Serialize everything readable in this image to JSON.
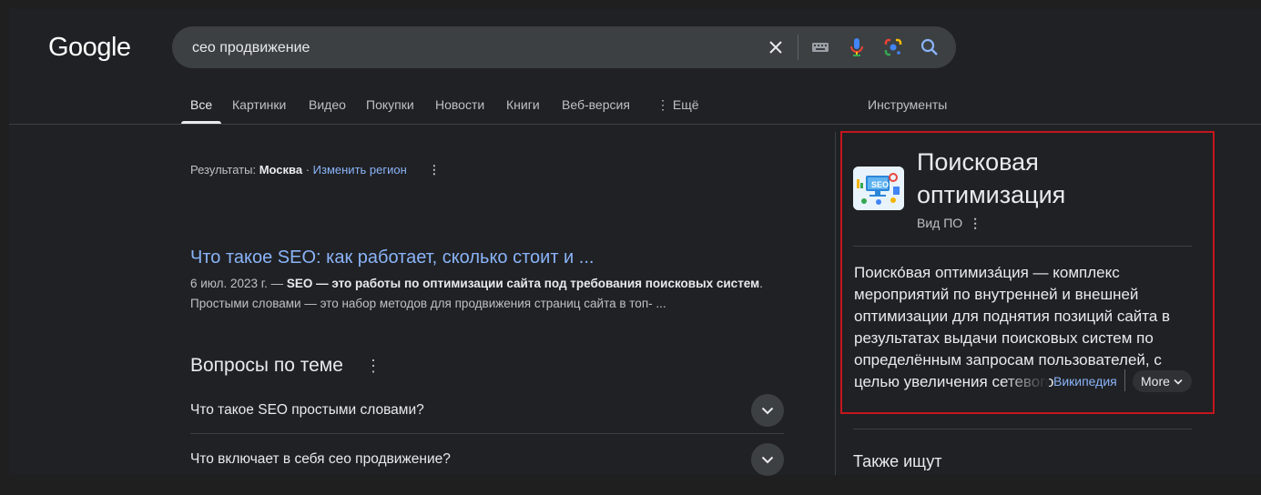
{
  "header": {
    "logo_text": "Google",
    "search_value": "сео продвижение",
    "icons": [
      "close-icon",
      "keyboard-icon",
      "microphone-icon",
      "google-lens-icon",
      "search-icon"
    ]
  },
  "tabs": {
    "all": "Все",
    "images": "Картинки",
    "video": "Видео",
    "shopping": "Покупки",
    "news": "Новости",
    "books": "Книги",
    "web": "Веб-версия",
    "more": "⋮ Ещё",
    "tools": "Инструменты"
  },
  "region": {
    "prefix": "Результаты: ",
    "city": "Москва",
    "separator": " · ",
    "change_link": "Изменить регион"
  },
  "result": {
    "title": "Что такое SEO: как работает, сколько стоит и ...",
    "date": "6 июл. 2023 г. — ",
    "snippet_bold": "SEO — это работы по оптимизации сайта под требования поисковых систем",
    "snippet_rest": ". Простыми словами — это набор методов для продвижения страниц сайта в топ- ..."
  },
  "paa": {
    "title": "Вопросы по теме",
    "questions": [
      "Что такое SEO простыми словами?",
      "Что включает в себя сео продвижение?"
    ]
  },
  "knowledge_panel": {
    "title": "Поисковая оптимизация",
    "subtitle": "Вид ПО",
    "description": "Поиско́вая оптимиза́ция — комплекс мероприятий по внутренней и внешней оптимизации для поднятия позиций сайта в результатах выдачи поисковых систем по определённым запросам пользователей, с целью увеличения сетевого",
    "source": "Википедия",
    "more": "More",
    "also_searched": "Также ищут",
    "thumbnail_text": "SEO"
  },
  "colors": {
    "background": "#202124",
    "link": "#8ab4f8",
    "highlight_border": "#c5161d"
  }
}
